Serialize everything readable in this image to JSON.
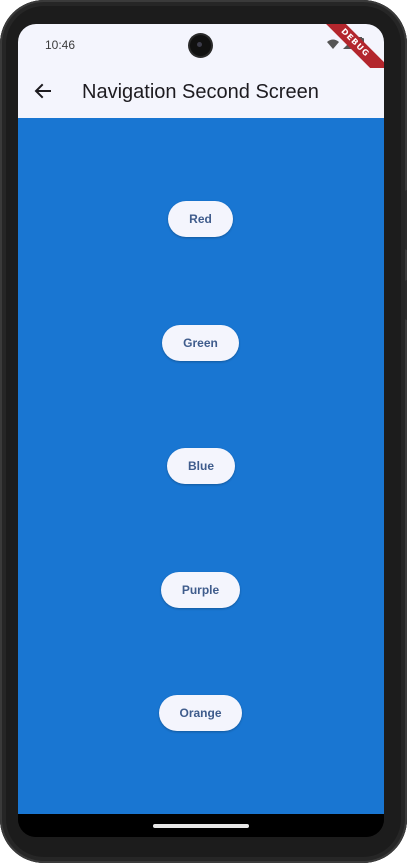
{
  "status_bar": {
    "time": "10:46",
    "icons": [
      "wifi-icon",
      "signal-icon",
      "battery-icon"
    ],
    "debug_banner": "DEBUG"
  },
  "app_bar": {
    "back_icon": "arrow-left-icon",
    "title": "Navigation Second Screen"
  },
  "main": {
    "background": "#1976d2",
    "buttons": [
      {
        "label": "Red"
      },
      {
        "label": "Green"
      },
      {
        "label": "Blue"
      },
      {
        "label": "Purple"
      },
      {
        "label": "Orange"
      }
    ]
  },
  "colors": {
    "app_bar_bg": "#f4f5fd",
    "button_bg": "#f4f5fd",
    "button_text": "#3f5c8c",
    "debug_banner": "#b3262d"
  }
}
